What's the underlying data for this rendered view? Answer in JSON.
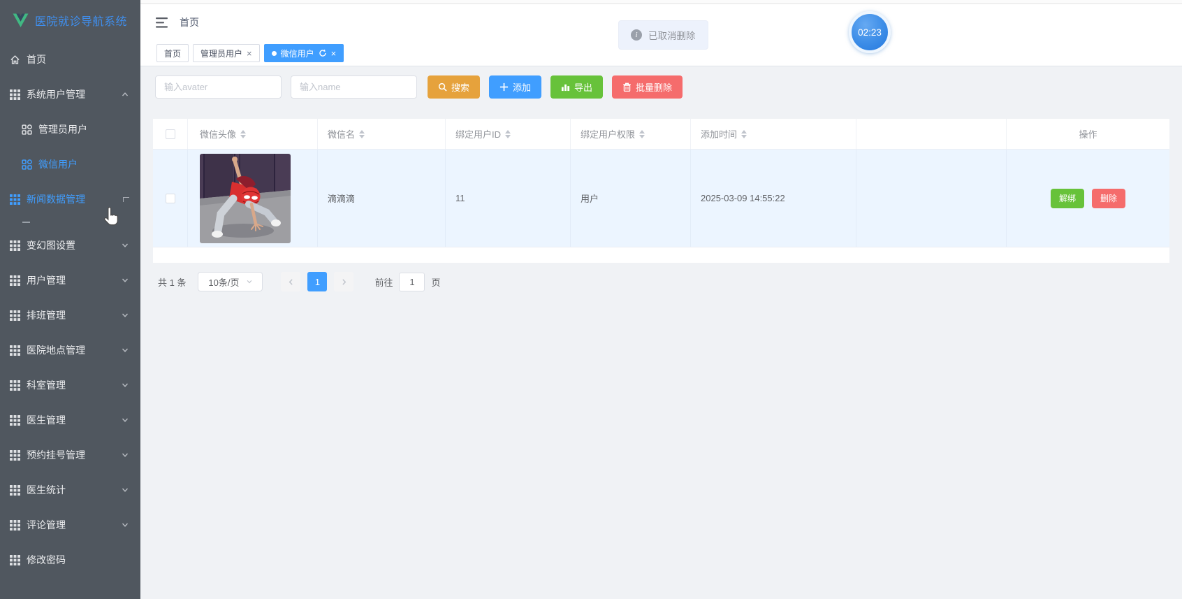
{
  "app": {
    "logo_text": "医院就诊导航系统"
  },
  "colors": {
    "accent": "#409EFF",
    "success": "#67C23A",
    "warning": "#E6A23C",
    "danger": "#F56C6C",
    "sidebar_bg": "#50575f",
    "row_highlight": "#ecf5ff"
  },
  "sidebar": {
    "items": [
      {
        "label": "首页"
      },
      {
        "label": "系统用户管理"
      },
      {
        "label": "管理员用户"
      },
      {
        "label": "微信用户"
      },
      {
        "label": "新闻数据管理"
      },
      {
        "label": "变幻图设置"
      },
      {
        "label": "用户管理"
      },
      {
        "label": "排班管理"
      },
      {
        "label": "医院地点管理"
      },
      {
        "label": "科室管理"
      },
      {
        "label": "医生管理"
      },
      {
        "label": "预约挂号管理"
      },
      {
        "label": "医生统计"
      },
      {
        "label": "评论管理"
      },
      {
        "label": "修改密码"
      }
    ]
  },
  "header": {
    "breadcrumb": "首页"
  },
  "tabs": [
    {
      "label": "首页"
    },
    {
      "label": "管理员用户"
    },
    {
      "label": "微信用户"
    }
  ],
  "toast": {
    "message": "已取消删除"
  },
  "overlay": {
    "timer": "02:23"
  },
  "toolbar": {
    "avatar_placeholder": "输入avater",
    "name_placeholder": "输入name",
    "search_label": "搜索",
    "add_label": "添加",
    "export_label": "导出",
    "batch_delete_label": "批量删除"
  },
  "table": {
    "columns": [
      {
        "label": "微信头像"
      },
      {
        "label": "微信名"
      },
      {
        "label": "绑定用户ID"
      },
      {
        "label": "绑定用户权限"
      },
      {
        "label": "添加时间"
      },
      {
        "label": "操作"
      }
    ],
    "rows": [
      {
        "wechat_name": "滴滴滴",
        "bind_user_id": "11",
        "bind_user_role": "用户",
        "add_time": "2025-03-09 14:55:22",
        "unbind_label": "解绑",
        "delete_label": "删除"
      }
    ]
  },
  "pagination": {
    "total": "共 1 条",
    "page_size": "10条/页",
    "page": "1",
    "goto_label": "前往",
    "goto_value": "1",
    "unit_label": "页"
  }
}
